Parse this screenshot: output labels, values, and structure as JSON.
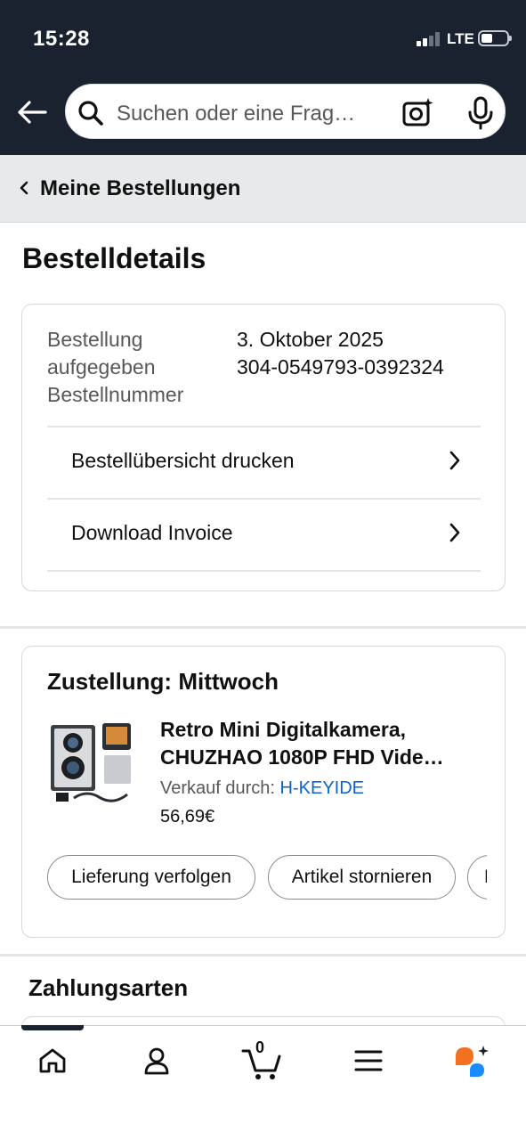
{
  "status_bar": {
    "time": "15:28",
    "network": "LTE"
  },
  "search": {
    "placeholder": "Suchen oder eine Frag…"
  },
  "breadcrumb": {
    "label": "Meine Bestellungen"
  },
  "page": {
    "title": "Bestelldetails"
  },
  "order": {
    "placed_label_line1": "Bestellung",
    "placed_label_line2": "aufgegeben",
    "number_label": "Bestellnummer",
    "date": "3. Oktober 2025",
    "number": "304-0549793-0392324",
    "links": [
      {
        "label": "Bestellübersicht drucken"
      },
      {
        "label": "Download Invoice"
      }
    ]
  },
  "delivery": {
    "title": "Zustellung: Mittwoch",
    "product": {
      "title_line1": "Retro Mini Digitalkamera,",
      "title_line2": "CHUZHAO 1080P FHD Vide…",
      "seller_prefix": "Verkauf durch:",
      "seller_name": "H-KEYIDE",
      "price": "56,69€"
    },
    "actions": [
      {
        "label": "Lieferung verfolgen"
      },
      {
        "label": "Artikel stornieren"
      },
      {
        "label": "P"
      }
    ]
  },
  "payment": {
    "title": "Zahlungsarten"
  },
  "tabbar": {
    "items": [
      {
        "icon": "home-icon"
      },
      {
        "icon": "account-icon"
      },
      {
        "icon": "cart-icon",
        "count": "0"
      },
      {
        "icon": "menu-icon"
      },
      {
        "icon": "assistant-icon"
      }
    ]
  },
  "colors": {
    "header_bg": "#1a2230",
    "link_blue": "#0a64c9",
    "assistant_orange": "#f36f21",
    "assistant_blue": "#1a8cff"
  }
}
